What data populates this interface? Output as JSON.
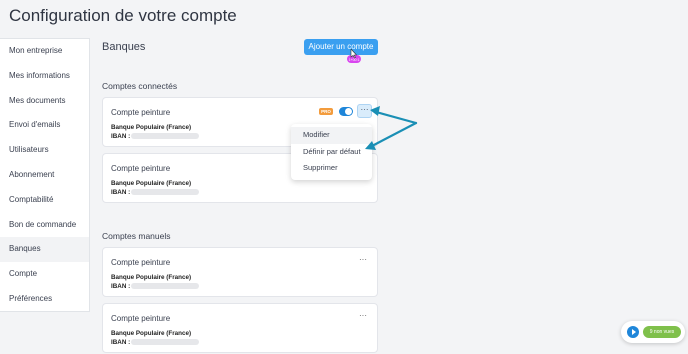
{
  "page": {
    "title": "Configuration de votre compte"
  },
  "sidebar": {
    "items": [
      {
        "label": "Mon entreprise"
      },
      {
        "label": "Mes informations"
      },
      {
        "label": "Mes documents"
      },
      {
        "label": "Envoi d'emails"
      },
      {
        "label": "Utilisateurs"
      },
      {
        "label": "Abonnement"
      },
      {
        "label": "Comptabilité"
      },
      {
        "label": "Bon de commande"
      },
      {
        "label": "Banques",
        "active": true
      },
      {
        "label": "Compte"
      },
      {
        "label": "Préférences"
      }
    ]
  },
  "main": {
    "title": "Banques",
    "add_button": "Ajouter un compte",
    "cursor_badge": "1+00:1",
    "connected_title": "Comptes connectés",
    "manual_title": "Comptes manuels",
    "pro_badge": "PRO",
    "more_glyph": "···",
    "connected_accounts": [
      {
        "name": "Compte peinture",
        "bank": "Banque Populaire (France)",
        "iban_label": "IBAN :"
      },
      {
        "name": "Compte peinture",
        "bank": "Banque Populaire (France)",
        "iban_label": "IBAN :"
      }
    ],
    "manual_accounts": [
      {
        "name": "Compte peinture",
        "bank": "Banque Populaire (France)",
        "iban_label": "IBAN :"
      },
      {
        "name": "Compte peinture",
        "bank": "Banque Populaire (France)",
        "iban_label": "IBAN :"
      }
    ]
  },
  "context_menu": {
    "items": [
      {
        "label": "Modifier"
      },
      {
        "label": "Définir par défaut"
      },
      {
        "label": "Supprimer"
      }
    ]
  },
  "widget": {
    "label": "9 non vues"
  },
  "colors": {
    "accent": "#3a9ff0",
    "toggle": "#1f86d9",
    "pro": "#f39c3d",
    "arrow": "#1a8fb5",
    "widget_pill": "#7fc04b"
  }
}
